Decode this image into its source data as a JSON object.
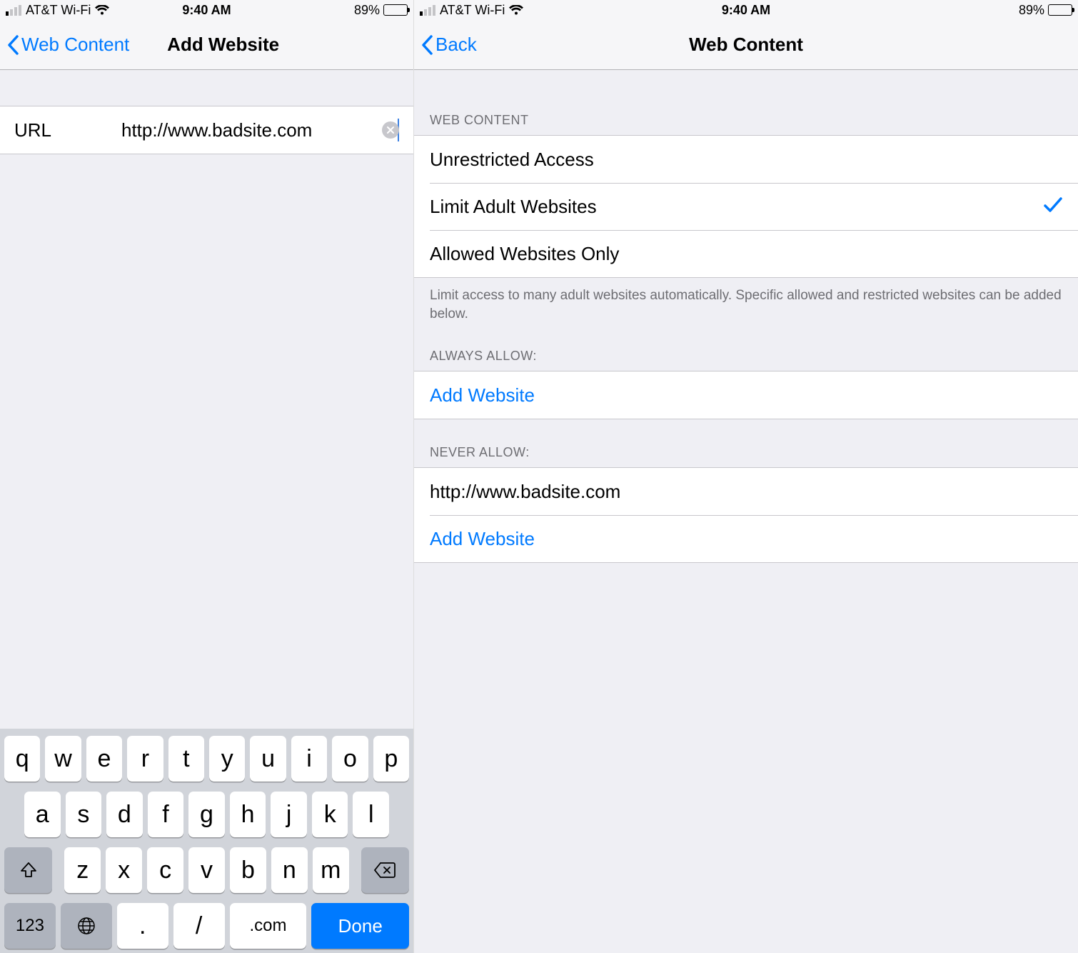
{
  "status_bar": {
    "carrier": "AT&T Wi-Fi",
    "time": "9:40 AM",
    "battery_pct": "89%",
    "battery_fill_pct": 89
  },
  "left": {
    "back_label": "Web Content",
    "title": "Add Website",
    "url_label": "URL",
    "url_value": "http://www.badsite.com"
  },
  "right": {
    "back_label": "Back",
    "title": "Web Content",
    "sections": {
      "web_content_header": "Web Content",
      "options": [
        {
          "label": "Unrestricted Access",
          "checked": false
        },
        {
          "label": "Limit Adult Websites",
          "checked": true
        },
        {
          "label": "Allowed Websites Only",
          "checked": false
        }
      ],
      "footer": "Limit access to many adult websites automatically. Specific allowed and restricted websites can be added below.",
      "always_allow_header": "Always Allow:",
      "always_allow_add": "Add Website",
      "never_allow_header": "Never Allow:",
      "never_allow_items": [
        "http://www.badsite.com"
      ],
      "never_allow_add": "Add Website"
    }
  },
  "keyboard": {
    "row1": [
      "q",
      "w",
      "e",
      "r",
      "t",
      "y",
      "u",
      "i",
      "o",
      "p"
    ],
    "row2": [
      "a",
      "s",
      "d",
      "f",
      "g",
      "h",
      "j",
      "k",
      "l"
    ],
    "row3": [
      "z",
      "x",
      "c",
      "v",
      "b",
      "n",
      "m"
    ],
    "num_key": "123",
    "period": ".",
    "slash": "/",
    "dotcom": ".com",
    "done": "Done"
  }
}
